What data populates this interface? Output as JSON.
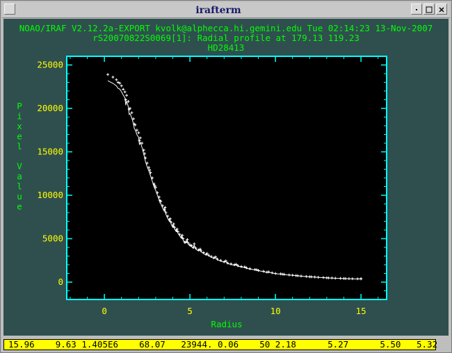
{
  "window": {
    "title": "irafterm"
  },
  "header": {
    "line1": "NOAO/IRAF V2.12.2a-EXPORT kvolk@alphecca.hi.gemini.edu Tue 02:14:23 13-Nov-2007",
    "line2": "rS20070822S0069[1]: Radial profile at 179.13 119.23",
    "line3": "HD28413"
  },
  "status_line": "15.96    9.63 1.405E6    68.07   23944. 0.06    50 2.18      5.27      5.50   5.32",
  "colors": {
    "screen_bg": "#2f4f4f",
    "header_text": "#00ff00",
    "tick_labels": "#ffff00",
    "axis_title": "#00ff00",
    "frame": "#00ffff",
    "data": "#ffffff",
    "status_bg": "#ffff00"
  },
  "chart_data": {
    "type": "scatter",
    "title": "",
    "xlabel": "Radius",
    "ylabel": "Pixel Value",
    "xlim": [
      -2.2,
      16.5
    ],
    "ylim": [
      -2000,
      26000
    ],
    "x_ticks": [
      0,
      5,
      10,
      15
    ],
    "y_ticks": [
      0,
      5000,
      10000,
      15000,
      20000,
      25000
    ],
    "x_tick_labels": [
      "0",
      "5",
      "10",
      "15"
    ],
    "y_tick_labels": [
      "0",
      "5000",
      "10000",
      "15000",
      "20000",
      "25000"
    ],
    "grid": false,
    "series": [
      {
        "points": [
          [
            0.2,
            23900
          ],
          [
            0.5,
            23600
          ],
          [
            0.7,
            23300
          ],
          [
            0.8,
            23000
          ],
          [
            0.9,
            22900
          ],
          [
            1.0,
            22600
          ],
          [
            1.1,
            22200
          ],
          [
            1.2,
            21900
          ],
          [
            1.3,
            21500
          ],
          [
            1.4,
            20800
          ],
          [
            1.5,
            20000
          ],
          [
            1.6,
            19500
          ],
          [
            1.7,
            18800
          ],
          [
            1.8,
            18100
          ],
          [
            1.9,
            17500
          ],
          [
            2.0,
            17200
          ],
          [
            2.1,
            16600
          ],
          [
            2.2,
            16000
          ],
          [
            2.3,
            15200
          ],
          [
            2.4,
            14300
          ],
          [
            2.5,
            13700
          ],
          [
            2.6,
            13200
          ],
          [
            2.7,
            12600
          ],
          [
            2.8,
            12000
          ],
          [
            2.9,
            11300
          ],
          [
            3.0,
            10900
          ],
          [
            3.1,
            10300
          ],
          [
            3.2,
            9800
          ],
          [
            3.3,
            9300
          ],
          [
            3.4,
            8800
          ],
          [
            3.5,
            8400
          ],
          [
            3.6,
            8000
          ],
          [
            3.7,
            7600
          ],
          [
            3.8,
            7200
          ],
          [
            3.9,
            6900
          ],
          [
            4.0,
            6500
          ],
          [
            4.2,
            6000
          ],
          [
            4.4,
            5500
          ],
          [
            4.6,
            5000
          ],
          [
            4.8,
            4700
          ],
          [
            5.0,
            4300
          ],
          [
            5.2,
            4000
          ],
          [
            5.5,
            3700
          ],
          [
            5.8,
            3400
          ],
          [
            6.1,
            3100
          ],
          [
            6.4,
            2800
          ],
          [
            6.8,
            2500
          ],
          [
            7.2,
            2200
          ],
          [
            7.6,
            2000
          ],
          [
            8.0,
            1800
          ],
          [
            8.5,
            1550
          ],
          [
            9.0,
            1350
          ],
          [
            9.5,
            1150
          ],
          [
            10.0,
            1000
          ],
          [
            10.5,
            900
          ],
          [
            11.0,
            800
          ],
          [
            11.5,
            700
          ],
          [
            12.0,
            620
          ],
          [
            12.5,
            560
          ],
          [
            13.0,
            500
          ],
          [
            13.5,
            450
          ],
          [
            14.0,
            420
          ],
          [
            14.5,
            390
          ],
          [
            15.0,
            370
          ],
          [
            1.25,
            21000
          ],
          [
            1.45,
            19900
          ],
          [
            1.75,
            18200
          ],
          [
            2.05,
            16300
          ],
          [
            2.35,
            14800
          ],
          [
            2.65,
            12900
          ],
          [
            2.95,
            11100
          ],
          [
            3.25,
            9400
          ],
          [
            3.55,
            8600
          ],
          [
            3.85,
            7300
          ],
          [
            4.1,
            6300
          ],
          [
            4.3,
            5800
          ],
          [
            4.5,
            5200
          ],
          [
            4.7,
            4600
          ],
          [
            4.9,
            4500
          ],
          [
            5.1,
            4200
          ],
          [
            5.35,
            3900
          ],
          [
            5.65,
            3600
          ],
          [
            5.95,
            3200
          ],
          [
            6.25,
            2950
          ],
          [
            6.6,
            2650
          ],
          [
            7.0,
            2350
          ],
          [
            7.4,
            2100
          ],
          [
            7.8,
            1900
          ],
          [
            8.3,
            1650
          ],
          [
            8.8,
            1450
          ],
          [
            9.3,
            1250
          ],
          [
            9.8,
            1080
          ],
          [
            10.3,
            950
          ],
          [
            10.8,
            830
          ],
          [
            11.3,
            740
          ],
          [
            11.8,
            660
          ],
          [
            12.3,
            590
          ],
          [
            12.8,
            530
          ],
          [
            13.3,
            480
          ],
          [
            13.8,
            440
          ],
          [
            14.3,
            400
          ],
          [
            14.8,
            380
          ],
          [
            4.05,
            6700
          ],
          [
            4.25,
            6100
          ],
          [
            4.55,
            5400
          ],
          [
            4.85,
            4900
          ],
          [
            5.25,
            4400
          ],
          [
            5.6,
            3800
          ],
          [
            6.0,
            3300
          ],
          [
            6.5,
            2900
          ],
          [
            7.1,
            2450
          ],
          [
            7.7,
            2050
          ],
          [
            8.2,
            1750
          ],
          [
            8.9,
            1420
          ],
          [
            9.6,
            1180
          ],
          [
            10.4,
            920
          ],
          [
            11.2,
            760
          ],
          [
            12.1,
            610
          ],
          [
            13.1,
            490
          ],
          [
            14.1,
            410
          ],
          [
            15.0,
            400
          ]
        ]
      }
    ]
  }
}
